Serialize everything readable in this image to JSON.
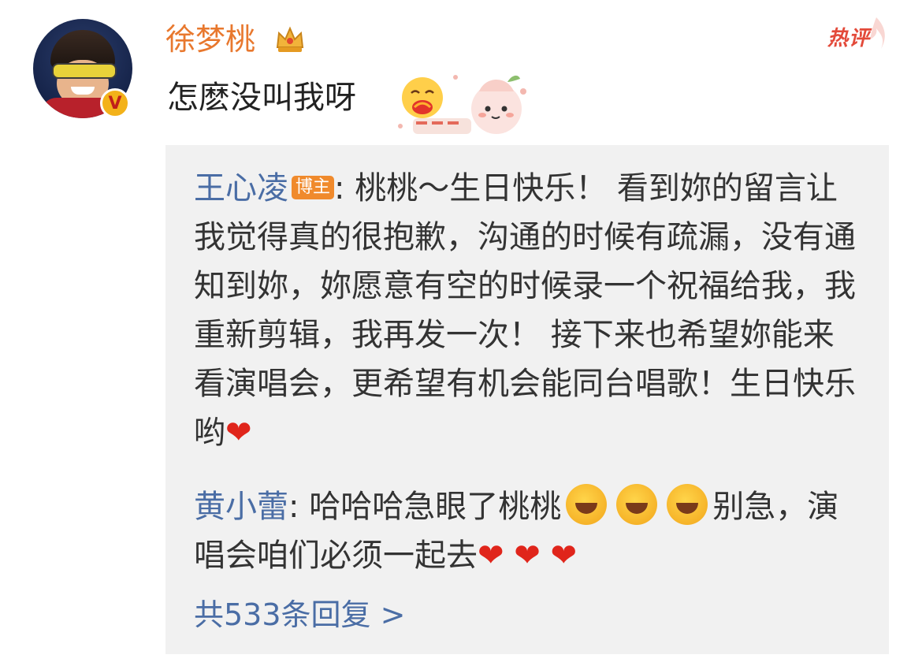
{
  "comment": {
    "username": "徐梦桃",
    "hot_label": "热评",
    "text": "怎麽没叫我呀",
    "avatar_badge": "V"
  },
  "replies": [
    {
      "name": "王心凌",
      "tag": "博主",
      "text": ": 桃桃～生日快乐！ 看到妳的留言让我觉得真的很抱歉，沟通的时候有疏漏，没有通知到妳，妳愿意有空的时候录一个祝福给我，我重新剪辑，我再发一次！ 接下来也希望妳能来看演唱会，更希望有机会能同台唱歌！生日快乐哟"
    },
    {
      "name": "黄小蕾",
      "text_before": ": 哈哈哈急眼了桃桃",
      "text_after": "别急，演唱会咱们必须一起去"
    }
  ],
  "more_replies": "共533条回复 >",
  "colors": {
    "username": "#e8782e",
    "reply_name": "#4a6da5",
    "hot": "#e34a3a",
    "reply_bg": "#f1f1f1"
  },
  "icons": [
    "crown-icon",
    "hug-emoji-icon",
    "peach-sticker-icon",
    "laugh-cry-emoji-icon",
    "heart-emoji-icon"
  ]
}
